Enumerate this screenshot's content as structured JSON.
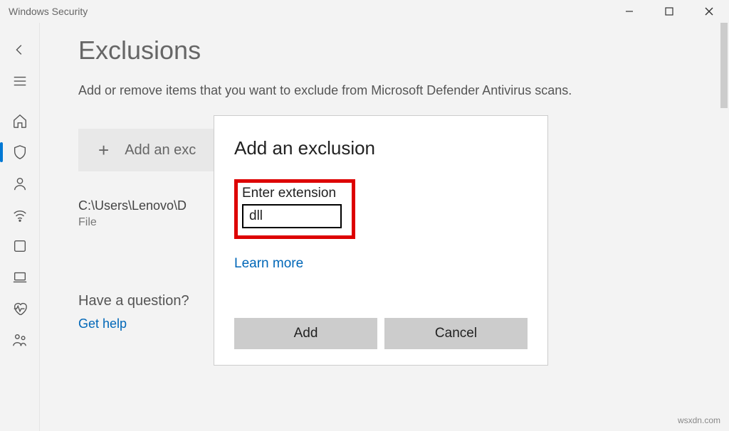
{
  "titlebar": {
    "title": "Windows Security"
  },
  "page": {
    "title": "Exclusions",
    "description": "Add or remove items that you want to exclude from Microsoft Defender Antivirus scans.",
    "add_button_label": "Add an exc"
  },
  "exclusion": {
    "path": "C:\\Users\\Lenovo\\D",
    "type": "File"
  },
  "question": {
    "title": "Have a question?",
    "link": "Get help"
  },
  "dialog": {
    "title": "Add an exclusion",
    "ext_label": "Enter extension",
    "ext_value": "dll",
    "learn_more": "Learn more",
    "add": "Add",
    "cancel": "Cancel"
  },
  "watermark": "wsxdn.com"
}
